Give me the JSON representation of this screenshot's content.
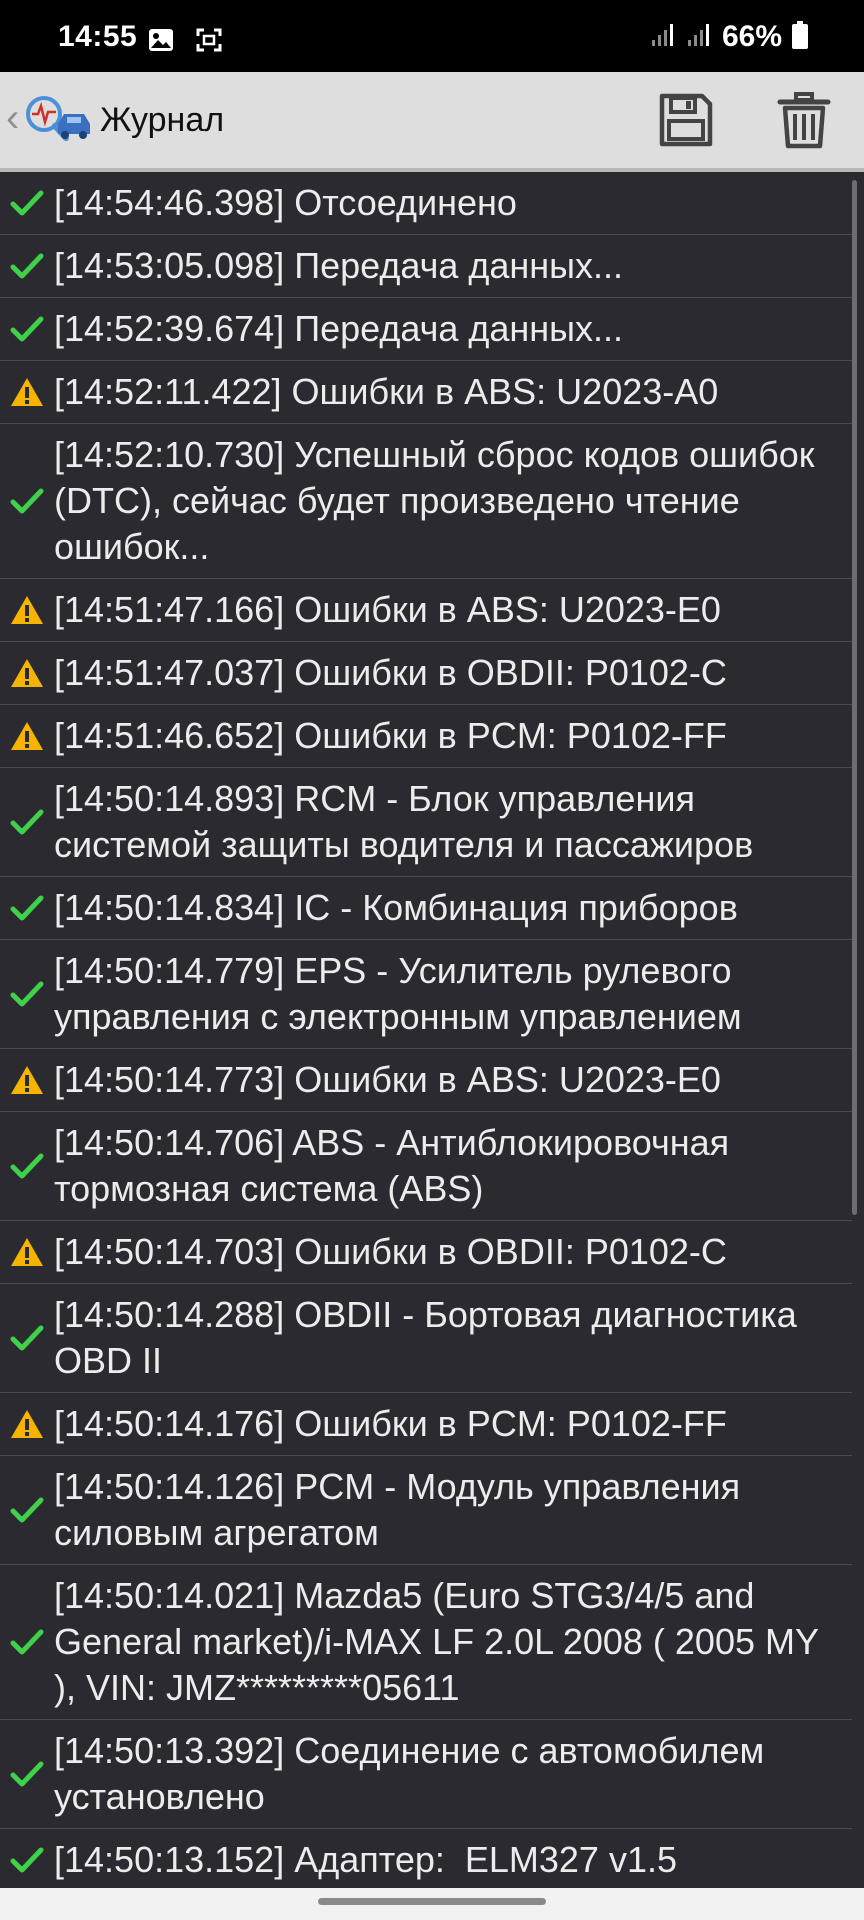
{
  "status_bar": {
    "time": "14:55",
    "battery": "66%",
    "icons": [
      "gallery-icon",
      "screenshot-icon",
      "signal-icon",
      "signal-icon",
      "battery-icon"
    ]
  },
  "toolbar": {
    "title": "Журнал",
    "back_icon": "chevron-left-icon",
    "logo_icon": "car-diagnostic-icon",
    "save_icon": "save-icon",
    "delete_icon": "trash-icon"
  },
  "colors": {
    "success": "#3fd14a",
    "warning": "#f5b400",
    "background": "#2a2a30",
    "text": "#ececec"
  },
  "log": [
    {
      "status": "success",
      "text": "[14:54:46.398] Отсоединено"
    },
    {
      "status": "success",
      "text": "[14:53:05.098] Передача данных..."
    },
    {
      "status": "success",
      "text": "[14:52:39.674] Передача данных..."
    },
    {
      "status": "warning",
      "text": "[14:52:11.422] Ошибки в ABS: U2023-A0"
    },
    {
      "status": "success",
      "text": "[14:52:10.730] Успешный сброс кодов ошибок (DTC), сейчас будет произведено чтение ошибок..."
    },
    {
      "status": "warning",
      "text": "[14:51:47.166] Ошибки в ABS: U2023-E0"
    },
    {
      "status": "warning",
      "text": "[14:51:47.037] Ошибки в OBDII: P0102-C"
    },
    {
      "status": "warning",
      "text": "[14:51:46.652] Ошибки в PCM: P0102-FF"
    },
    {
      "status": "success",
      "text": "[14:50:14.893] RCM - Блок управления системой защиты водителя и пассажиров"
    },
    {
      "status": "success",
      "text": "[14:50:14.834] IC - Комбинация приборов"
    },
    {
      "status": "success",
      "text": "[14:50:14.779] EPS - Усилитель рулевого управления с электронным управлением"
    },
    {
      "status": "warning",
      "text": "[14:50:14.773] Ошибки в ABS: U2023-E0"
    },
    {
      "status": "success",
      "text": "[14:50:14.706] ABS - Антиблокировочная тормозная система (ABS)"
    },
    {
      "status": "warning",
      "text": "[14:50:14.703] Ошибки в OBDII: P0102-C"
    },
    {
      "status": "success",
      "text": "[14:50:14.288] OBDII - Бортовая диагностика OBD II"
    },
    {
      "status": "warning",
      "text": "[14:50:14.176] Ошибки в PCM: P0102-FF"
    },
    {
      "status": "success",
      "text": "[14:50:14.126] PCM - Модуль управления силовым агрегатом"
    },
    {
      "status": "success",
      "text": "[14:50:14.021] Mazda5 (Euro STG3/4/5 and General market)/i-MAX LF 2.0L 2008 ( 2005 MY ), VIN: JMZ*********05611"
    },
    {
      "status": "success",
      "text": "[14:50:13.392] Соединение с автомобилем установлено"
    },
    {
      "status": "success",
      "text": "[14:50:13.152] Адаптер:  ELM327 v1.5"
    }
  ]
}
